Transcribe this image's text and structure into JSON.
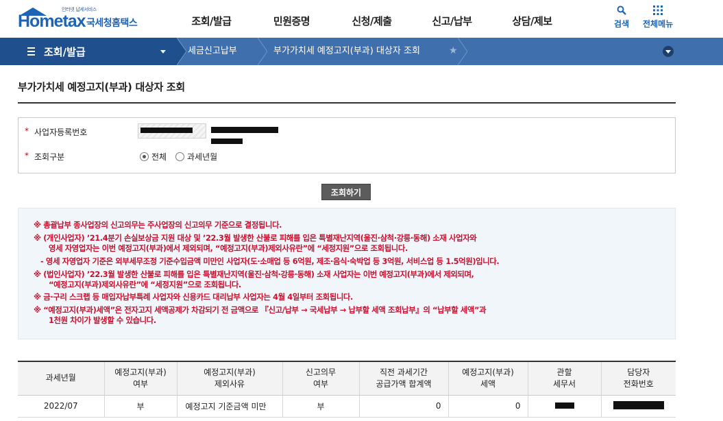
{
  "header": {
    "logo_sub": "인터넷 납세서비스",
    "logo_main": "Hometax",
    "logo_kor": "국세청홈택스",
    "nav": [
      "조회/발급",
      "민원증명",
      "신청/제출",
      "신고/납부",
      "상담/제보"
    ],
    "search_label": "검색",
    "allmenu_label": "전체메뉴"
  },
  "location": {
    "menu": "조회/발급",
    "crumbs": [
      "세금신고납부",
      "부가가치세 예정고지(부과) 대상자 조회"
    ]
  },
  "page": {
    "title": "부가가치세 예정고지(부과) 대상자 조회"
  },
  "form": {
    "bizno_label": "사업자등록번호",
    "type_label": "조회구분",
    "options": [
      "전체",
      "과세년월"
    ],
    "selected": "전체",
    "required_mark": "*"
  },
  "search_button": "조회하기",
  "notices": [
    "※ 총괄납부 종사업장의 신고의무는 주사업장의 신고의무 기준으로 결정됩니다.",
    "※ (개인사업자) ’21.4분기 손실보상금 지원 대상 및 ’22.3월 발생한 산불로 피해를 입은 특별재난지역(울진·삼척·강릉·동해) 소재 사업자와",
    "영세 자영업자는 이번 예정고지(부과)에서 제외되며, “예정고지(부과)제외사유란”에 “세정지원”으로 조회됩니다.",
    "- 영세 자영업자 기준은 외부세무조정 기준수입금액 미만인 사업자(도·소매업 등 6억원, 제조·음식·숙박업 등 3억원, 서비스업 등 1.5억원)입니다.",
    "※ (법인사업자) ’22.3월 발생한 산불로 피해를 입은 특별재난지역(울진·삼척·강릉·동해) 소재 사업자는 이번 예정고지(부과)에서 제외되며,",
    "“예정고지(부과)제외사유란”에 “세정지원”으로 조회됩니다.",
    "※ 금·구리 스크랩 등 매입자납부특례 사업자와 신용카드 대리납부 사업자는 4월 4일부터 조회됩니다.",
    "※ “예정고지(부과)세액”은 전자고지 세액공제가 차감되기 전 금액으로 『신고/납부 → 국세납부 → 납부할 세액 조회납부』의 “납부할 세액”과",
    "1천원 차이가 발생할 수 있습니다."
  ],
  "table": {
    "headers": [
      [
        "과세년월"
      ],
      [
        "예정고지(부과)",
        "여부"
      ],
      [
        "예정고지(부과)",
        "제외사유"
      ],
      [
        "신고의무",
        "여부"
      ],
      [
        "직전 과세기간",
        "공급가액 합계액"
      ],
      [
        "예정고지(부과)",
        "세액"
      ],
      [
        "관할",
        "세무서"
      ],
      [
        "담당자",
        "전화번호"
      ]
    ],
    "rows": [
      {
        "period": "2022/07",
        "notice_yn": "부",
        "exclude_reason": "예정고지 기준금액 미만",
        "duty_yn": "부",
        "prev_supply": "0",
        "tax_amount": "0"
      }
    ]
  }
}
